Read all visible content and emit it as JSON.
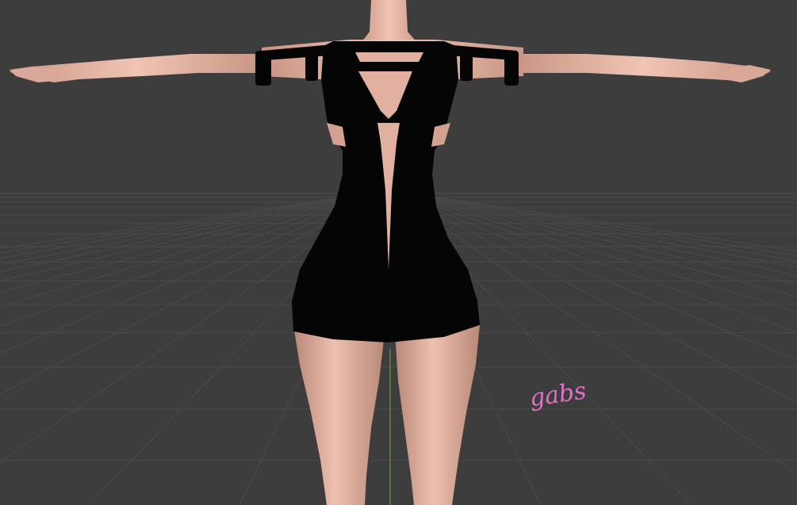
{
  "viewport": {
    "background_color": "#3d3d3d",
    "grid_color": "#4a4a4a",
    "y_axis_color": "#6a9a3a",
    "grid_visible": true
  },
  "model": {
    "skin_color": "#e8b8a8",
    "skin_shadow_color": "#c99585",
    "dress_color": "#050505",
    "pose": "t-pose"
  },
  "watermark": {
    "text": "gabs",
    "color": "#e070c8"
  }
}
